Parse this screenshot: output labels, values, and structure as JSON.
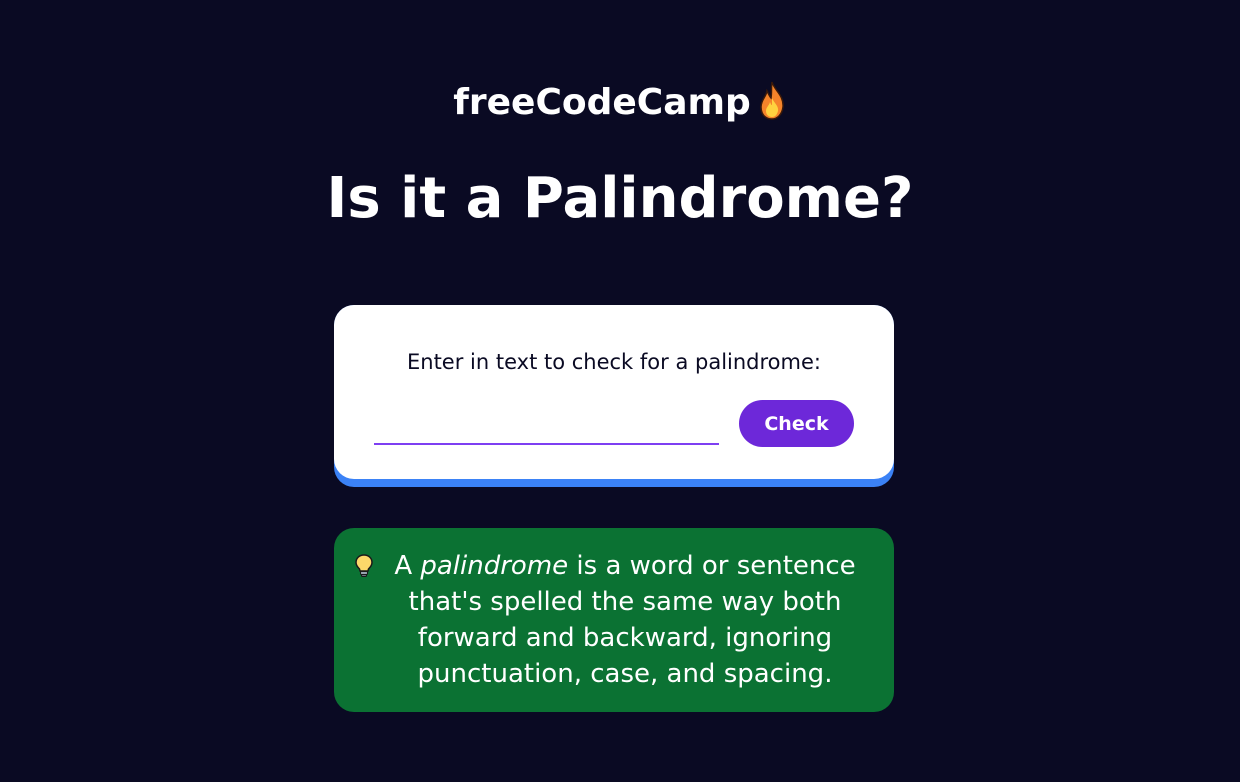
{
  "header": {
    "brand": "freeCodeCamp",
    "flame_icon": "fire-icon",
    "title": "Is it a Palindrome?"
  },
  "form": {
    "label": "Enter in text to check for a palindrome:",
    "input_value": "",
    "input_placeholder": "",
    "button_label": "Check"
  },
  "info": {
    "icon": "lightbulb-icon",
    "prefix": "A ",
    "term": "palindrome",
    "body": " is a word or sentence that's spelled the same way both forward and backward, ignoring punctuation, case, and spacing."
  },
  "colors": {
    "background": "#0a0a23",
    "card": "#ffffff",
    "card_accent": "#3b82f6",
    "button": "#6d28d9",
    "input_underline": "#7e3ff2",
    "info_background": "#0b7233"
  }
}
